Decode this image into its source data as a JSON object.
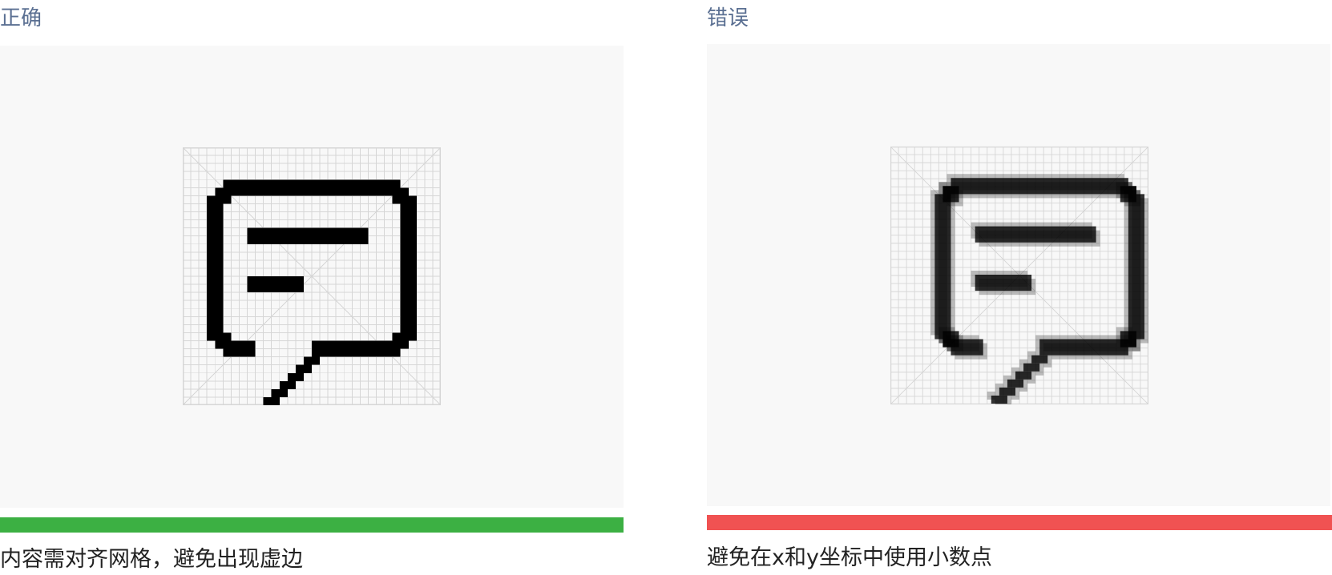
{
  "comparison": {
    "correct": {
      "title": "正确",
      "caption": "内容需对齐网格，避免出现虚边",
      "bar_color": "#3cb043",
      "icon": "speech-bubble-icon"
    },
    "incorrect": {
      "title": "错误",
      "caption": "避免在x和y坐标中使用小数点",
      "bar_color": "#f05252",
      "icon": "speech-bubble-icon"
    }
  },
  "colors": {
    "title_text": "#5a6f92",
    "canvas_bg": "#f8f8f8",
    "grid_line": "#d6d6d6",
    "icon_stroke": "#000000"
  }
}
